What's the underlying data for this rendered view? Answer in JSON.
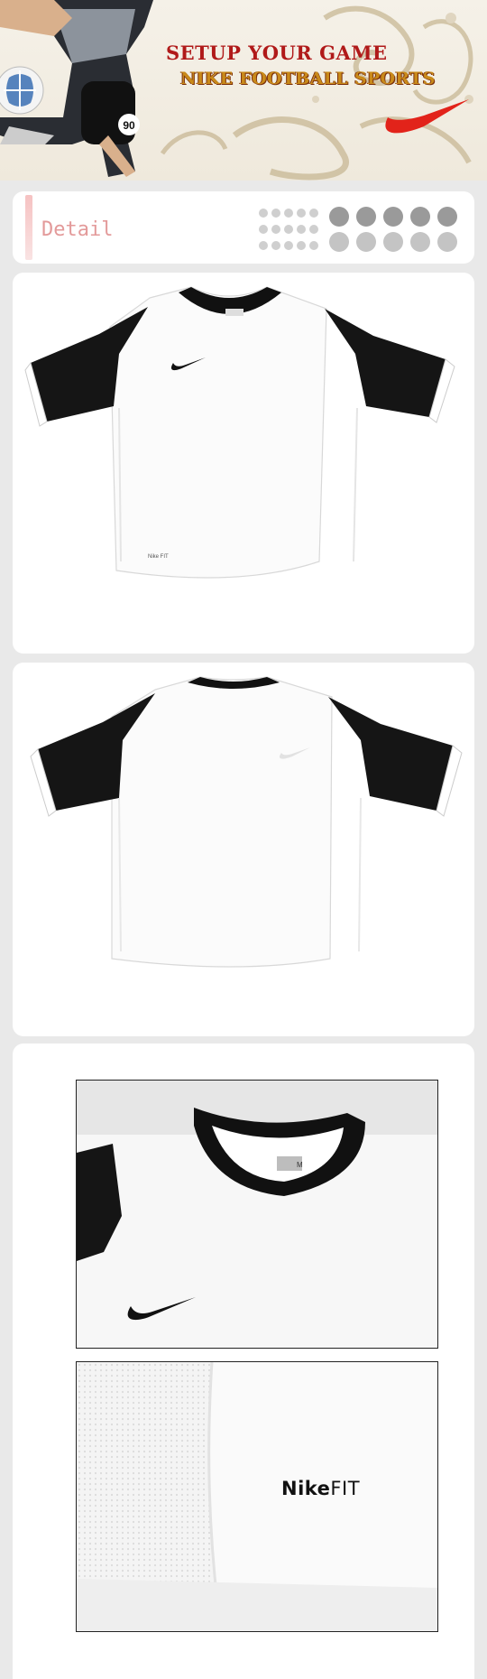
{
  "banner": {
    "headline": "SETUP YOUR GAME",
    "subline": "NIKE FOOTBALL SPORTS",
    "brand_color": "#e2231a"
  },
  "detail": {
    "label": "Detail",
    "accent": "#f6c2c2"
  },
  "photos": {
    "front_icon": "shirt-front",
    "back_icon": "shirt-back",
    "closeup_collar": "collar-closeup",
    "closeup_fabric": "fabric-closeup",
    "tag_size": "M",
    "fabric_logo_brand": "Nike",
    "fabric_logo_line": "FIT"
  }
}
